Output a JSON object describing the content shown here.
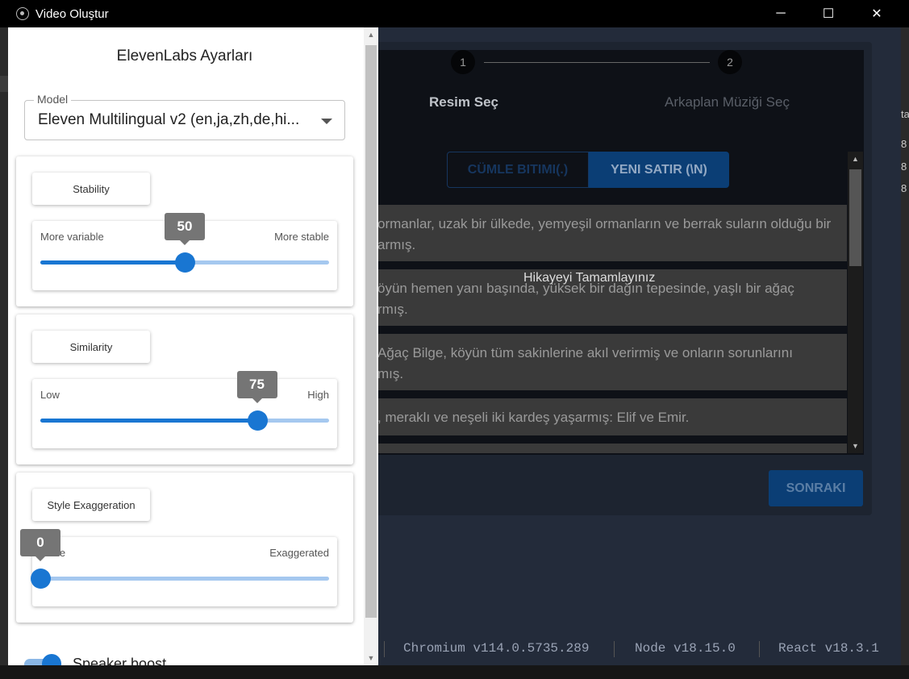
{
  "window": {
    "title": "Video Oluştur",
    "minimize_glyph": "─",
    "maximize_glyph": "☐",
    "close_glyph": "✕"
  },
  "background": {
    "steps": [
      {
        "number": "1",
        "label": "Resim Seç"
      },
      {
        "number": "2",
        "label": "Arkaplan Müziği Seç"
      }
    ],
    "segments": {
      "sentence_end": "CÜMLE BITIMI(.)",
      "new_line": "YENI SATIR (\\N)"
    },
    "story_rows": [
      {
        "line1": "ormanlar, uzak bir ülkede, yemyeşil ormanların ve berrak suların olduğu bir",
        "line2": "armış."
      },
      {
        "line1": "öyün hemen yanı başında, yüksek bir dağın tepesinde, yaşlı bir ağaç",
        "line2": "rmış."
      },
      {
        "line1": "Ağaç Bilge, köyün tüm sakinlerine akıl verirmiş ve onların sorunlarını",
        "line2": "mış."
      },
      {
        "line1": ", meraklı ve neşeli iki kardeş yaşarmış: Elif ve Emir.",
        "line2": ""
      }
    ],
    "overlay_text": "Hikayeyi Tamamlayınız",
    "next_button": "SONRAKI",
    "versions": {
      "chromium": "Chromium v114.0.5735.289",
      "node": "Node v18.15.0",
      "react": "React v18.3.1"
    },
    "right_edge": [
      "ta",
      "8",
      "8",
      "8"
    ]
  },
  "modal": {
    "title": "ElevenLabs Ayarları",
    "model": {
      "label": "Model",
      "value": "Eleven Multilingual v2 (en,ja,zh,de,hi..."
    },
    "sliders": [
      {
        "name": "Stability",
        "min_label": "More variable",
        "max_label": "More stable",
        "value": 50,
        "display": "50"
      },
      {
        "name": "Similarity",
        "min_label": "Low",
        "max_label": "High",
        "value": 75,
        "display": "75"
      },
      {
        "name": "Style Exaggeration",
        "min_label": "None",
        "max_label": "Exaggerated",
        "value": 0,
        "display": "0"
      }
    ],
    "speaker_boost": {
      "label": "Speaker boost",
      "enabled": true
    }
  },
  "colors": {
    "accent": "#1976d2",
    "accent_light": "#a5c8ef",
    "tooltip": "#757575"
  }
}
